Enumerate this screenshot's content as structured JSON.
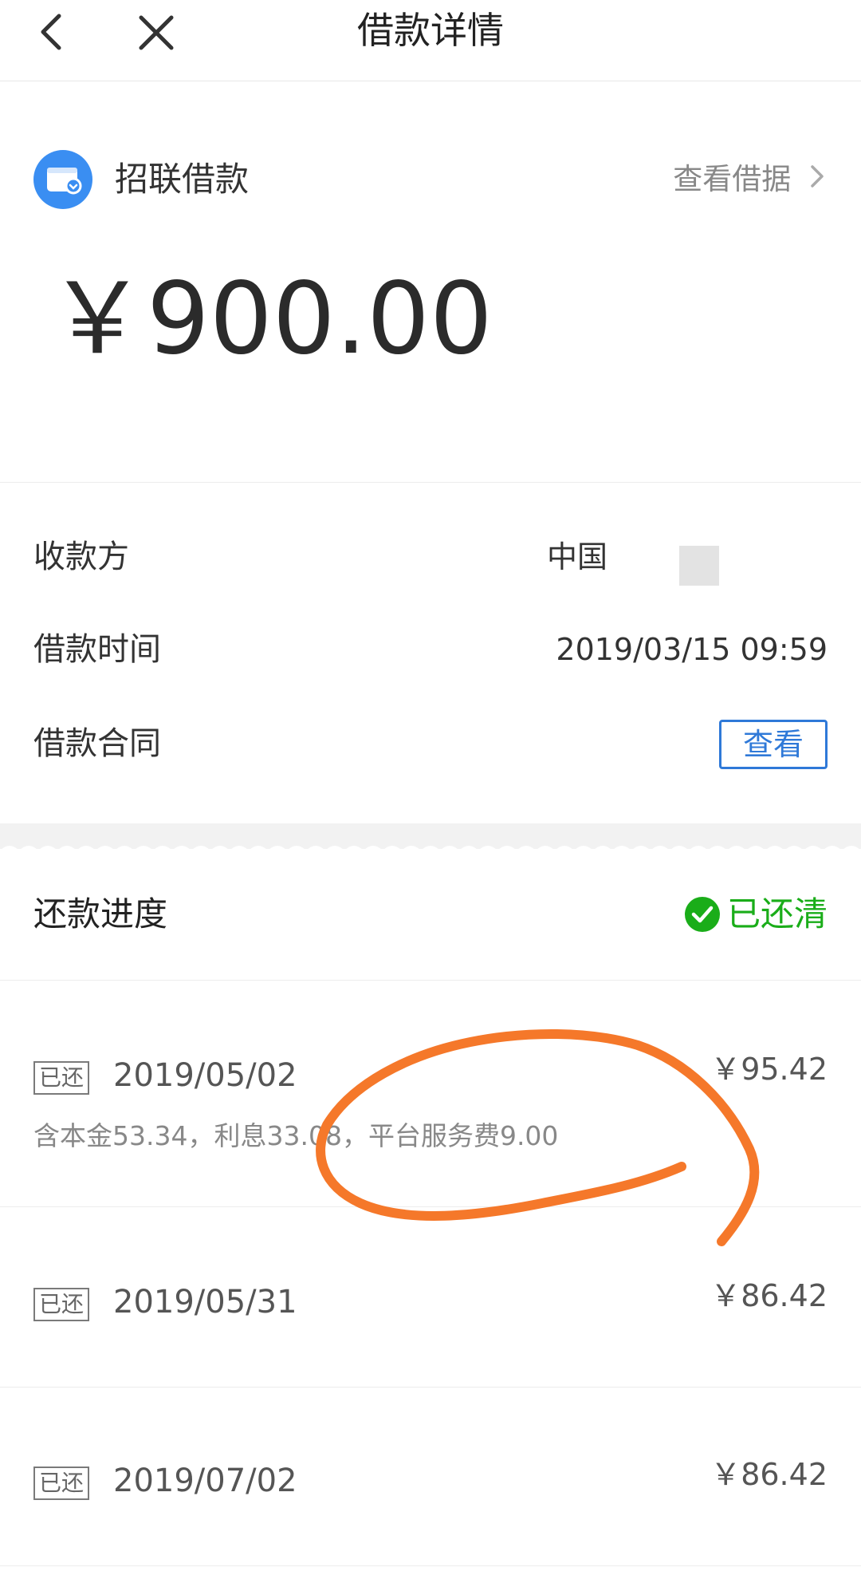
{
  "header": {
    "title": "借款详情",
    "back_icon": "chevron-left-icon",
    "close_icon": "close-icon"
  },
  "loan": {
    "product_name": "招联借款",
    "view_receipt_label": "查看借据",
    "amount": "￥900.00",
    "logo_icon": "wallet-icon",
    "logo_color": "#3a8ef2"
  },
  "info": {
    "payee_label": "收款方",
    "payee_value": "中国",
    "time_label": "借款时间",
    "time_value": "2019/03/15 09:59",
    "contract_label": "借款合同",
    "contract_button": "查看",
    "accent_color": "#2f79d8"
  },
  "repayment": {
    "title": "还款进度",
    "status": "已还清",
    "status_color": "#1aad19",
    "items": [
      {
        "tag": "已还",
        "date": "2019/05/02",
        "amount": "￥95.42",
        "detail": "含本金53.34，利息33.08，平台服务费9.00"
      },
      {
        "tag": "已还",
        "date": "2019/05/31",
        "amount": "￥86.42"
      },
      {
        "tag": "已还",
        "date": "2019/07/02",
        "amount": "￥86.42"
      }
    ]
  },
  "annotation_color": "#f5782a"
}
